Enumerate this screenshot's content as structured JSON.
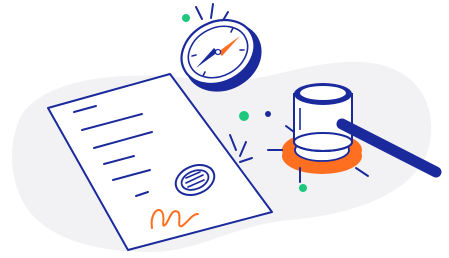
{
  "illustration": {
    "subject": "legal-contract-illustration",
    "colors": {
      "ink": "#1a2a9c",
      "accent": "#ff6f1f",
      "green": "#1fc77e",
      "blob": "#f2f2f4",
      "paper": "#ffffff"
    }
  }
}
